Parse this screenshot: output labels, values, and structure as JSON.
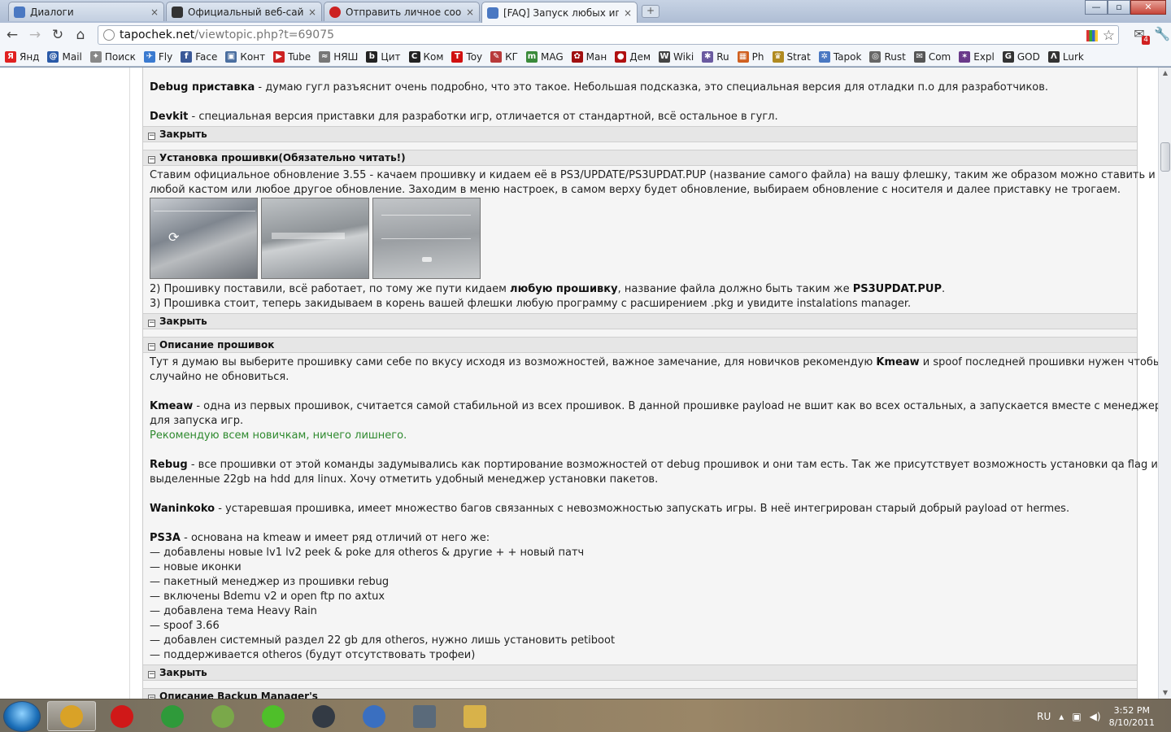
{
  "tabs": [
    {
      "title": "Диалоги",
      "close": "×",
      "color": "#4a78c2"
    },
    {
      "title": "Официальный веб-сайт Pl",
      "close": "×",
      "color": "#333333"
    },
    {
      "title": "Отправить личное сообщ",
      "close": "×",
      "color": "#cc2222"
    },
    {
      "title": "[FAQ] Запуск любых игр и",
      "close": "×",
      "color": "#4a78c2"
    }
  ],
  "new_tab_label": "+",
  "window_buttons": {
    "minimize": "—",
    "maximize": "▫",
    "close": "✕"
  },
  "toolbar": {
    "back": "←",
    "forward": "→",
    "reload": "↻",
    "home": "⌂",
    "star": "☆",
    "wrench": "🔧",
    "mail_badge": "4"
  },
  "address": {
    "host": "tapochek.net",
    "path": "/viewtopic.php?t=69075"
  },
  "bookmarks": [
    {
      "label": "Янд",
      "color": "#e02020",
      "glyph": "Я"
    },
    {
      "label": "Mail",
      "color": "#2a5aa8",
      "glyph": "@"
    },
    {
      "label": "Поиск",
      "color": "#888888",
      "glyph": "✦"
    },
    {
      "label": "Fly",
      "color": "#3a7ad0",
      "glyph": "✈"
    },
    {
      "label": "Face",
      "color": "#3b5998",
      "glyph": "f"
    },
    {
      "label": "Конт",
      "color": "#4a6ea0",
      "glyph": "▣"
    },
    {
      "label": "Tube",
      "color": "#cc2222",
      "glyph": "▶"
    },
    {
      "label": "НЯШ",
      "color": "#777777",
      "glyph": "≈"
    },
    {
      "label": "Цит",
      "color": "#222222",
      "glyph": "b"
    },
    {
      "label": "Ком",
      "color": "#222222",
      "glyph": "C"
    },
    {
      "label": "Toy",
      "color": "#d01010",
      "glyph": "T"
    },
    {
      "label": "КГ",
      "color": "#b83a3a",
      "glyph": "✎"
    },
    {
      "label": "MAG",
      "color": "#3a8a3a",
      "glyph": "m"
    },
    {
      "label": "Ман",
      "color": "#a01010",
      "glyph": "✿"
    },
    {
      "label": "Дем",
      "color": "#b01010",
      "glyph": "●"
    },
    {
      "label": "Wiki",
      "color": "#444444",
      "glyph": "W"
    },
    {
      "label": "Ru",
      "color": "#6a5aa0",
      "glyph": "✱"
    },
    {
      "label": "Ph",
      "color": "#d06020",
      "glyph": "▦"
    },
    {
      "label": "Strat",
      "color": "#b08a20",
      "glyph": "♛"
    },
    {
      "label": "Tapok",
      "color": "#4a78c2",
      "glyph": "✲"
    },
    {
      "label": "Rust",
      "color": "#666666",
      "glyph": "◎"
    },
    {
      "label": "Com",
      "color": "#555555",
      "glyph": "✉"
    },
    {
      "label": "Expl",
      "color": "#6a3a8a",
      "glyph": "✶"
    },
    {
      "label": "GOD",
      "color": "#333333",
      "glyph": "G"
    },
    {
      "label": "Lurk",
      "color": "#333333",
      "glyph": "Λ"
    }
  ],
  "page": {
    "debug_title": "Debug приставка",
    "debug_text": " - думаю гугл разъяснит очень подробно, что это такое. Небольшая подсказка, это специальная версия для отладки п.о для разработчиков.",
    "devkit_title": "Devkit",
    "devkit_text": " - специальная версия приставки для разработки игр, отличается от стандартной, всё остальное в гугл.",
    "close_label": "Закрыть",
    "toggle_minus": "−",
    "install_header": "Установка прошивки(Обязательно читать!)",
    "install_l1": "Ставим официальное обновление 3.55 - качаем прошивку и кидаем её в PS3/UPDATE/PS3UPDAT.PUP (название самого файла) на вашу флешку, таким же образом можно ставить и",
    "install_l2": "любой кастом или любое другое обновление. Заходим в меню настроек, в самом верху будет обновление, выбираем обновление с носителя и далее приставку не трогаем.",
    "install_l3_a": "2) Прошивку поставили, всё работает, по тому же пути кидаем ",
    "install_l3_b": "любую прошивку",
    "install_l3_c": ", название файла должно быть таким же ",
    "install_l3_d": "PS3UPDAT.PUP",
    "install_l3_e": ".",
    "install_l4": "3) Прошивка стоит, теперь закидываем в корень вашей флешки любую программу с расширением .pkg и увидите instalations manager.",
    "desc_header": "Описание прошивок",
    "desc_l1_a": "Тут я думаю вы выберите прошивку сами себе по вкусу исходя из возможностей, важное замечание, для новичков рекомендую ",
    "desc_l1_b": "Kmeaw",
    "desc_l1_c": " и spoof последней прошивки нужен чтобы",
    "desc_l2": "случайно не обновиться.",
    "kmeaw_title": "Kmeaw",
    "kmeaw_text": " - одна из первых прошивок, считается самой стабильной из всех прошивок. В данной прошивке payload не вшит как во всех остальных, а запускается вместе с менеджером",
    "kmeaw_text2": "для запуска игр.",
    "kmeaw_rec": "Рекомендую всем новичкам, ничего лишнего.",
    "rebug_title": "Rebug",
    "rebug_text": " - все прошивки от этой команды задумывались как портирование возможностей от debug прошивок и они там есть. Так же присутствует возможность установки qa flag и есть",
    "rebug_text2": "выделенные 22gb на hdd для linux. Хочу отметить удобный менеджер установки пакетов.",
    "wan_title": "Waninkoko",
    "wan_text": " - устаревшая прошивка, имеет множество багов связанных с невозможностью запускать игры. В неё интегрирован старый добрый payload от hermes.",
    "ps3a_title": "PS3A",
    "ps3a_text": " - основана на kmeaw и имеет ряд отличий от него же:",
    "ps3a_items": [
      "— добавлены новые lv1 lv2 peek & poke для otheros & другие + + новый патч",
      "— новые иконки",
      "— пакетный менеджер из прошивки rebug",
      "— включены Bdemu v2 и open ftp по axtux",
      "— добавлена тема Heavy Rain",
      "— spoof 3.66",
      "— добавлен системный раздел 22 gb для otheros, нужно лишь установить petiboot",
      "— поддерживается otheros (будут отсутствовать трофеи)"
    ],
    "backup_header": "Описание Backup Manager's"
  },
  "taskbar": {
    "lang": "RU",
    "time": "3:52 PM",
    "date": "8/10/2011",
    "apps": [
      {
        "name": "chrome",
        "color": "#d9a227"
      },
      {
        "name": "opera",
        "color": "#d01818"
      },
      {
        "name": "utorrent",
        "color": "#2f9a3a"
      },
      {
        "name": "tool",
        "color": "#7aa84a"
      },
      {
        "name": "icq",
        "color": "#4fbf2a"
      },
      {
        "name": "steam",
        "color": "#333a44"
      },
      {
        "name": "itunes",
        "color": "#3a6fc0"
      },
      {
        "name": "control",
        "color": "#5a6a7a"
      },
      {
        "name": "explorer",
        "color": "#d8b24a"
      }
    ]
  }
}
